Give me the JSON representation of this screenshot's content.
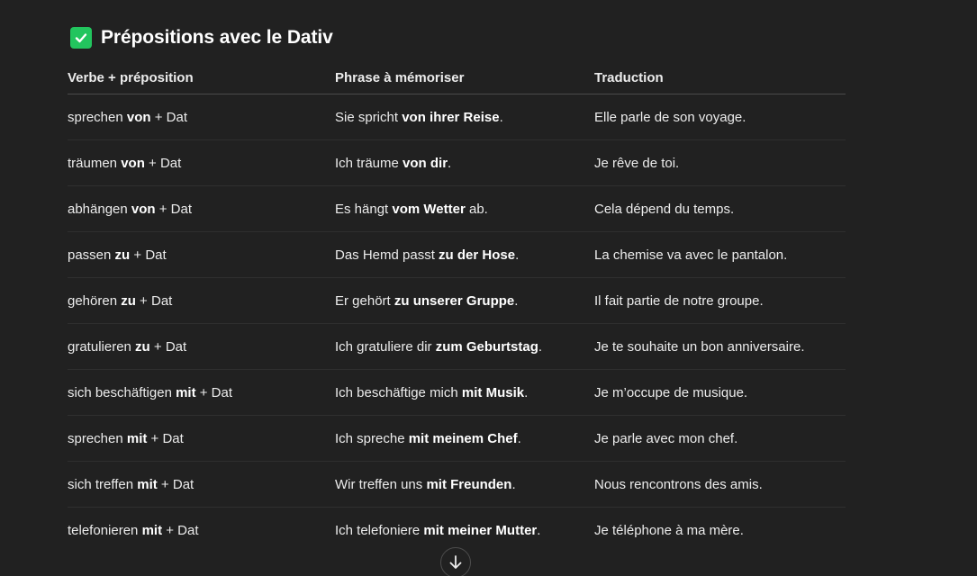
{
  "section": {
    "check_icon": "check-mark-icon",
    "title": "Prépositions avec le Dativ"
  },
  "table": {
    "headers": [
      "Verbe + préposition",
      "Phrase à mémoriser",
      "Traduction"
    ],
    "rows": [
      {
        "verb": {
          "pre": "sprechen ",
          "bold": "von",
          "post": " + Dat"
        },
        "phrase": {
          "pre": "Sie spricht ",
          "bold": "von ihrer Reise",
          "post": "."
        },
        "translation": "Elle parle de son voyage."
      },
      {
        "verb": {
          "pre": "träumen ",
          "bold": "von",
          "post": " + Dat"
        },
        "phrase": {
          "pre": "Ich träume ",
          "bold": "von dir",
          "post": "."
        },
        "translation": "Je rêve de toi."
      },
      {
        "verb": {
          "pre": "abhängen ",
          "bold": "von",
          "post": " + Dat"
        },
        "phrase": {
          "pre": "Es hängt ",
          "bold": "vom Wetter",
          "post": " ab."
        },
        "translation": "Cela dépend du temps."
      },
      {
        "verb": {
          "pre": "passen ",
          "bold": "zu",
          "post": " + Dat"
        },
        "phrase": {
          "pre": "Das Hemd passt ",
          "bold": "zu der Hose",
          "post": "."
        },
        "translation": "La chemise va avec le pantalon."
      },
      {
        "verb": {
          "pre": "gehören ",
          "bold": "zu",
          "post": " + Dat"
        },
        "phrase": {
          "pre": "Er gehört ",
          "bold": "zu unserer Gruppe",
          "post": "."
        },
        "translation": "Il fait partie de notre groupe."
      },
      {
        "verb": {
          "pre": "gratulieren ",
          "bold": "zu",
          "post": " + Dat"
        },
        "phrase": {
          "pre": "Ich gratuliere dir ",
          "bold": "zum Geburtstag",
          "post": "."
        },
        "translation": "Je te souhaite un bon anniversaire."
      },
      {
        "verb": {
          "pre": "sich beschäftigen ",
          "bold": "mit",
          "post": " + Dat"
        },
        "phrase": {
          "pre": "Ich beschäftige mich ",
          "bold": "mit Musik",
          "post": "."
        },
        "translation": "Je m’occupe de musique."
      },
      {
        "verb": {
          "pre": "sprechen ",
          "bold": "mit",
          "post": " + Dat"
        },
        "phrase": {
          "pre": "Ich spreche ",
          "bold": "mit meinem Chef",
          "post": "."
        },
        "translation": "Je parle avec mon chef."
      },
      {
        "verb": {
          "pre": "sich treffen ",
          "bold": "mit",
          "post": " + Dat"
        },
        "phrase": {
          "pre": "Wir treffen uns ",
          "bold": "mit Freunden",
          "post": "."
        },
        "translation": "Nous rencontrons des amis."
      },
      {
        "verb": {
          "pre": "telefonieren ",
          "bold": "mit",
          "post": " + Dat"
        },
        "phrase": {
          "pre": "Ich telefoniere ",
          "bold": "mit meiner Mutter",
          "post": "."
        },
        "translation": "Je téléphone à ma mère."
      }
    ]
  },
  "scroll_button": {
    "icon": "arrow-down-icon"
  },
  "colors": {
    "background": "#212121",
    "text": "#ececec",
    "check_green": "#22c55e"
  }
}
